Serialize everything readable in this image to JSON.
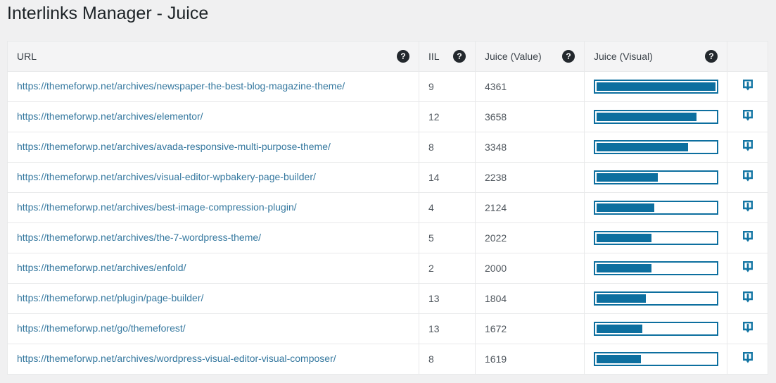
{
  "page": {
    "title": "Interlinks Manager - Juice"
  },
  "colors": {
    "accent_blue": "#0d6f9f",
    "link_blue": "#35789f",
    "help_icon_bg": "#23282d",
    "header_bg": "#f4f4f5",
    "page_bg": "#f0f0f1"
  },
  "icons": {
    "help_glyph": "?",
    "row_action": "download-arrow"
  },
  "table": {
    "columns": {
      "url": {
        "label": "URL"
      },
      "iil": {
        "label": "IIL"
      },
      "juice_value": {
        "label": "Juice (Value)"
      },
      "juice_visual": {
        "label": "Juice (Visual)"
      },
      "actions": {
        "label": ""
      }
    },
    "max_juice": 4361,
    "rows": [
      {
        "url": "https://themeforwp.net/archives/newspaper-the-best-blog-magazine-theme/",
        "iil": "9",
        "juice": 4361
      },
      {
        "url": "https://themeforwp.net/archives/elementor/",
        "iil": "12",
        "juice": 3658
      },
      {
        "url": "https://themeforwp.net/archives/avada-responsive-multi-purpose-theme/",
        "iil": "8",
        "juice": 3348
      },
      {
        "url": "https://themeforwp.net/archives/visual-editor-wpbakery-page-builder/",
        "iil": "14",
        "juice": 2238
      },
      {
        "url": "https://themeforwp.net/archives/best-image-compression-plugin/",
        "iil": "4",
        "juice": 2124
      },
      {
        "url": "https://themeforwp.net/archives/the-7-wordpress-theme/",
        "iil": "5",
        "juice": 2022
      },
      {
        "url": "https://themeforwp.net/archives/enfold/",
        "iil": "2",
        "juice": 2000
      },
      {
        "url": "https://themeforwp.net/plugin/page-builder/",
        "iil": "13",
        "juice": 1804
      },
      {
        "url": "https://themeforwp.net/go/themeforest/",
        "iil": "13",
        "juice": 1672
      },
      {
        "url": "https://themeforwp.net/archives/wordpress-visual-editor-visual-composer/",
        "iil": "8",
        "juice": 1619
      }
    ]
  }
}
